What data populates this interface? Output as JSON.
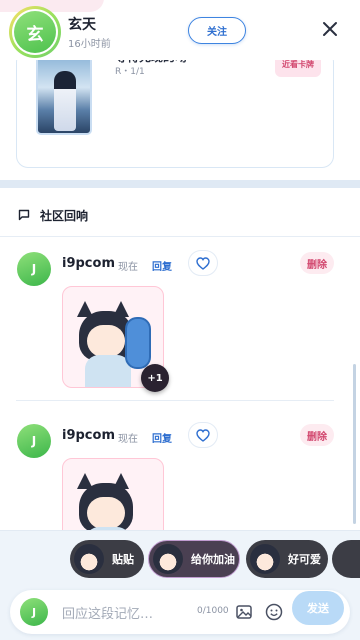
{
  "header": {
    "avatar_char": "玄",
    "name": "玄天",
    "time": "16小时前",
    "follow_label": "关注"
  },
  "memory": {
    "title": "等待兑现的吻",
    "meta": "R・1/1",
    "button_label": "近看卡牌"
  },
  "community": {
    "title": "社区回响",
    "comments": [
      {
        "avatar": "J",
        "name": "i9pcom",
        "time": "现在",
        "reply": "回复",
        "delete": "删除",
        "extra_count": "+1"
      },
      {
        "avatar": "J",
        "name": "i9pcom",
        "time": "现在",
        "reply": "回复",
        "delete": "删除"
      }
    ]
  },
  "reactions": [
    {
      "label": "贴贴"
    },
    {
      "label": "给你加油"
    },
    {
      "label": "好可爱"
    }
  ],
  "input": {
    "avatar": "J",
    "placeholder": "回应这段记忆…",
    "counter": "0/1000",
    "send_label": "发送"
  },
  "colors": {
    "accent_blue": "#2f6fd0",
    "delete_pink": "#d2486f",
    "avatar_green": "#4ec24e"
  }
}
